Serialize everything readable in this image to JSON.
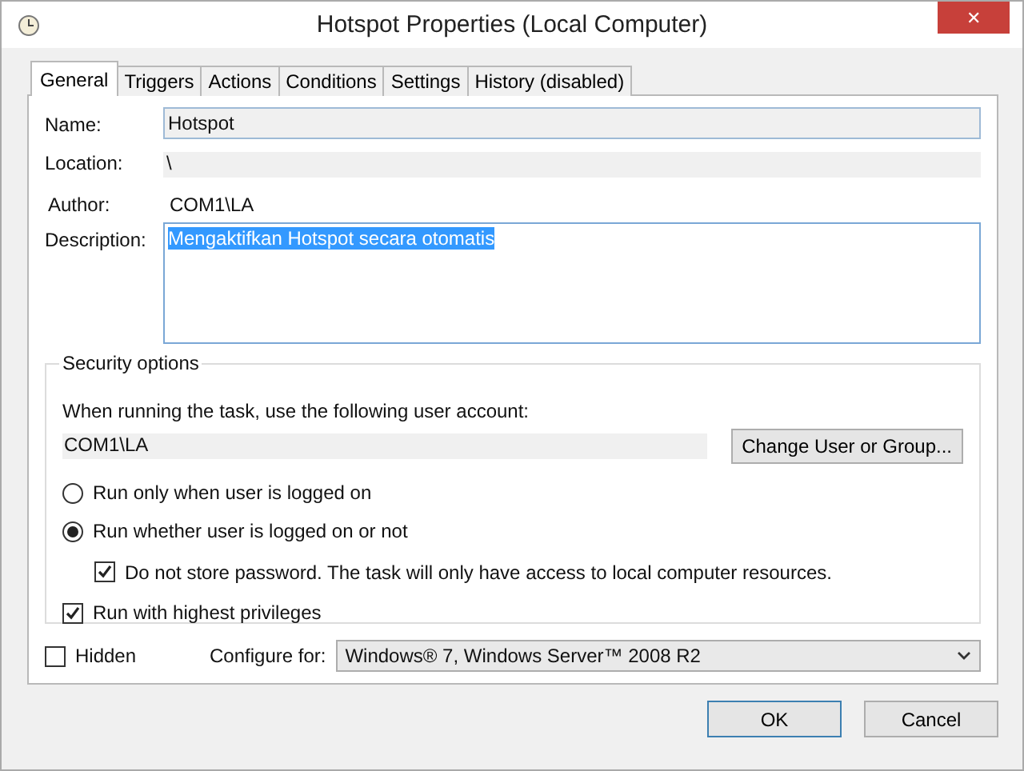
{
  "window": {
    "title": "Hotspot Properties (Local Computer)",
    "close": "✕"
  },
  "tabs": [
    {
      "label": "General",
      "selected": true
    },
    {
      "label": "Triggers",
      "selected": false
    },
    {
      "label": "Actions",
      "selected": false
    },
    {
      "label": "Conditions",
      "selected": false
    },
    {
      "label": "Settings",
      "selected": false
    },
    {
      "label": "History (disabled)",
      "selected": false
    }
  ],
  "fields": [
    {
      "label": "Name:",
      "value": "Hotspot",
      "kind": "input"
    },
    {
      "label": "Location:",
      "value": "\\",
      "kind": "readonly"
    },
    {
      "label": "Author:",
      "value": "COM1\\LA",
      "kind": "plain"
    },
    {
      "label": "Description:",
      "value": "Mengaktifkan Hotspot secara otomatis",
      "kind": "textarea",
      "text_selected": true
    }
  ],
  "security": {
    "title": "Security options",
    "prompt": "When running the task, use the following user account:",
    "account": "COM1\\LA",
    "change_button": "Change User or Group...",
    "options": [
      {
        "label": "Run only when user is logged on",
        "kind": "radio",
        "checked": false
      },
      {
        "label": "Run whether user is logged on or not",
        "kind": "radio",
        "checked": true
      },
      {
        "label": "Do not store password.  The task will only have access to local computer resources.",
        "kind": "subcheck",
        "checked": true
      },
      {
        "label": "Run with highest privileges",
        "kind": "check",
        "checked": true
      }
    ]
  },
  "hidden": {
    "label": "Hidden",
    "checked": false
  },
  "configure": {
    "label": "Configure for:",
    "value": "Windows® 7, Windows Server™ 2008 R2"
  },
  "buttons": [
    {
      "label": "OK",
      "default": true
    },
    {
      "label": "Cancel",
      "default": false
    }
  ]
}
